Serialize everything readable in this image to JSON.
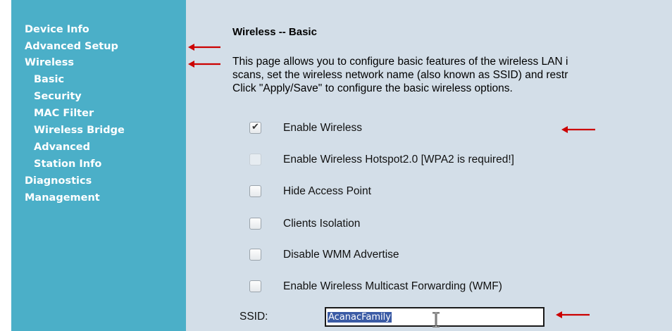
{
  "sidebar": {
    "items": [
      {
        "label": "Device Info",
        "level": 0
      },
      {
        "label": "Advanced Setup",
        "level": 0
      },
      {
        "label": "Wireless",
        "level": 0
      },
      {
        "label": "Basic",
        "level": 1
      },
      {
        "label": "Security",
        "level": 1
      },
      {
        "label": "MAC Filter",
        "level": 1
      },
      {
        "label": "Wireless Bridge",
        "level": 1
      },
      {
        "label": "Advanced",
        "level": 1
      },
      {
        "label": "Station Info",
        "level": 1
      },
      {
        "label": "Diagnostics",
        "level": 0
      },
      {
        "label": "Management",
        "level": 0
      }
    ]
  },
  "main": {
    "title": "Wireless -- Basic",
    "description": [
      "This page allows you to configure basic features of the wireless LAN i",
      "scans, set the wireless network name (also known as SSID) and restr",
      "Click \"Apply/Save\" to configure the basic wireless options."
    ],
    "options": [
      {
        "label": "Enable Wireless",
        "checked": true,
        "disabled": false
      },
      {
        "label": "Enable Wireless Hotspot2.0 [WPA2 is required!]",
        "checked": false,
        "disabled": true
      },
      {
        "label": "Hide Access Point",
        "checked": false,
        "disabled": false
      },
      {
        "label": "Clients Isolation",
        "checked": false,
        "disabled": false
      },
      {
        "label": "Disable WMM Advertise",
        "checked": false,
        "disabled": false
      },
      {
        "label": "Enable Wireless Multicast Forwarding (WMF)",
        "checked": false,
        "disabled": false
      }
    ],
    "ssid": {
      "label": "SSID:",
      "value": "AcanacFamily"
    }
  },
  "colors": {
    "sidebar_bg": "#4bafc8",
    "content_bg": "#d3dee8",
    "annotation_arrow": "#cc0000",
    "selection": "#3b5ba5"
  },
  "annotations": [
    "arrow-advanced-setup",
    "arrow-wireless",
    "arrow-enable-wireless",
    "arrow-ssid"
  ]
}
